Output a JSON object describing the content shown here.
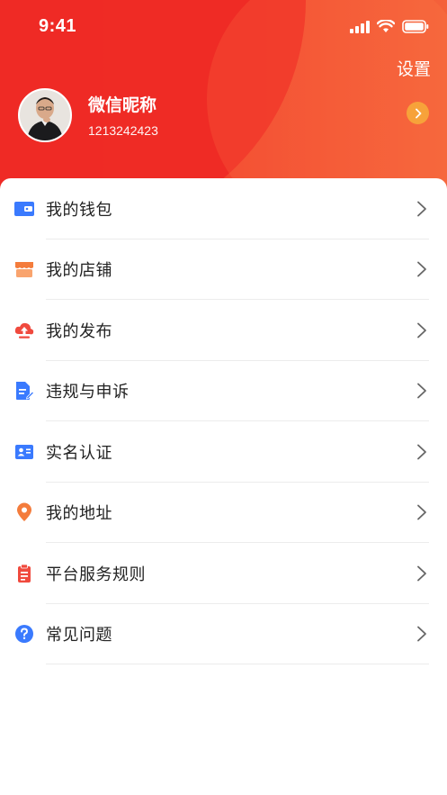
{
  "status_bar": {
    "time": "9:41"
  },
  "header": {
    "settings_label": "设置"
  },
  "profile": {
    "nickname": "微信昵称",
    "user_id": "1213242423"
  },
  "menu": {
    "items": [
      {
        "label": "我的钱包",
        "icon": "wallet-icon",
        "color": "#3a7afe"
      },
      {
        "label": "我的店铺",
        "icon": "store-icon",
        "color": "#f47c3c"
      },
      {
        "label": "我的发布",
        "icon": "upload-cloud-icon",
        "color": "#f04a3e"
      },
      {
        "label": "违规与申诉",
        "icon": "document-edit-icon",
        "color": "#3a7afe"
      },
      {
        "label": "实名认证",
        "icon": "id-card-icon",
        "color": "#3a7afe"
      },
      {
        "label": "我的地址",
        "icon": "location-pin-icon",
        "color": "#f47c3c"
      },
      {
        "label": "平台服务规则",
        "icon": "clipboard-icon",
        "color": "#f04a3e"
      },
      {
        "label": "常见问题",
        "icon": "question-icon",
        "color": "#3a7afe"
      }
    ]
  }
}
